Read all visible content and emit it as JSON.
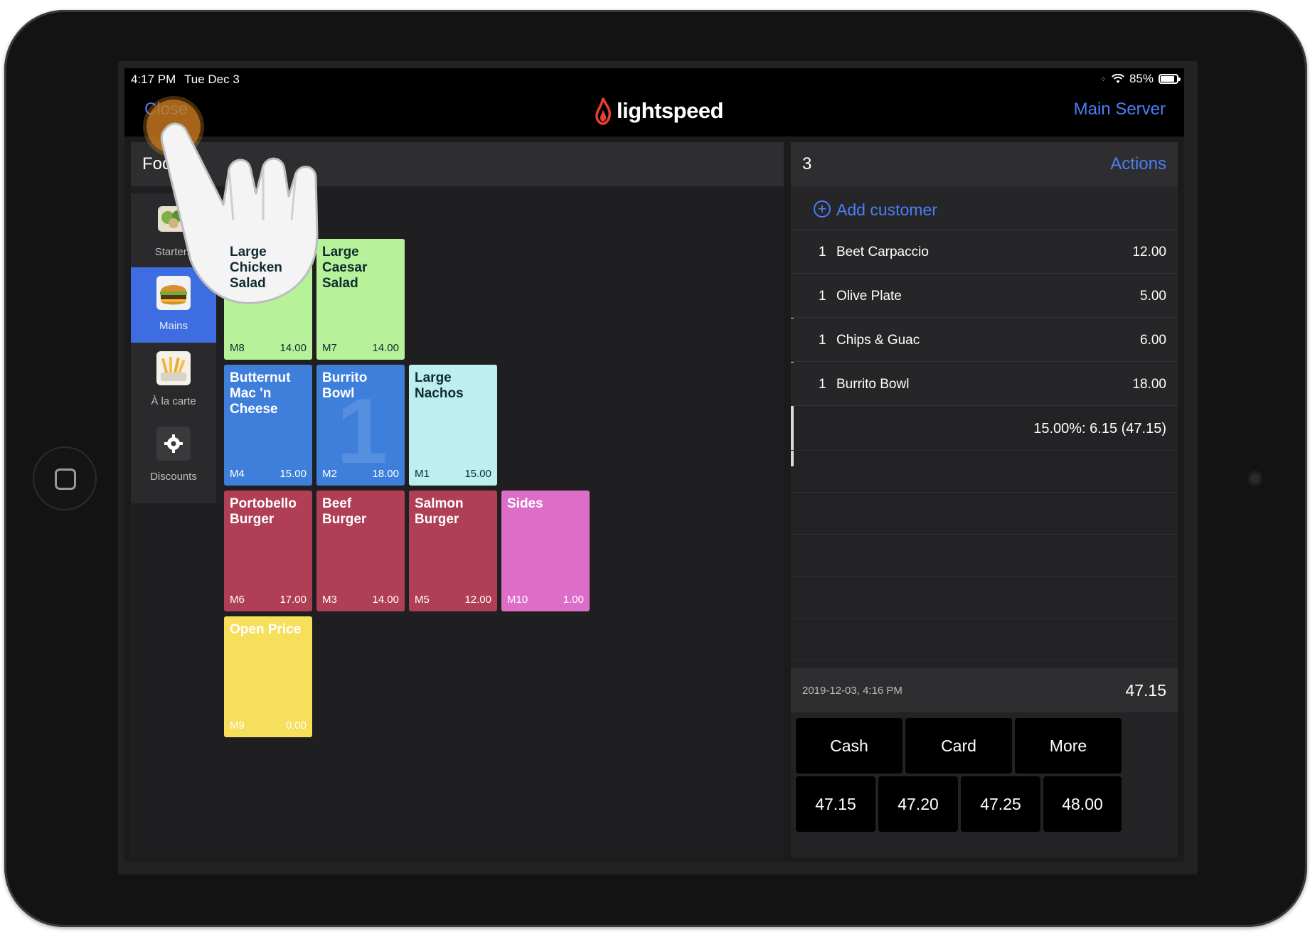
{
  "status_bar": {
    "time": "4:17 PM",
    "date": "Tue Dec 3",
    "battery": "85%",
    "battery_level": 0.85
  },
  "nav": {
    "close": "Close",
    "logo": "lightspeed",
    "server": "Main Server"
  },
  "category": {
    "label": "Food"
  },
  "sidebar": [
    {
      "label": "Starters",
      "icon": "salad-icon",
      "active": false
    },
    {
      "label": "Mains",
      "icon": "burger-icon",
      "active": true
    },
    {
      "label": "À la carte",
      "icon": "fries-icon",
      "active": false
    },
    {
      "label": "Discounts",
      "icon": "discount-gear-icon",
      "active": false
    }
  ],
  "tiles": [
    {
      "name": "Large Chicken Salad",
      "code": "M8",
      "price": "14.00",
      "color": "#b7f29a"
    },
    {
      "name": "Large Caesar Salad",
      "code": "M7",
      "price": "14.00",
      "color": "#b7f29a"
    },
    {
      "name": "Butternut Mac 'n Cheese",
      "code": "M4",
      "price": "15.00",
      "color": "#3f7fdc"
    },
    {
      "name": "Burrito Bowl",
      "code": "M2",
      "price": "18.00",
      "color": "#3f7fdc",
      "badge": "1"
    },
    {
      "name": "Large Nachos",
      "code": "M1",
      "price": "15.00",
      "color": "#bdeef0"
    },
    {
      "name": "Portobello Burger",
      "code": "M6",
      "price": "17.00",
      "color": "#b03f55"
    },
    {
      "name": "Beef Burger",
      "code": "M3",
      "price": "14.00",
      "color": "#b03f55"
    },
    {
      "name": "Salmon Burger",
      "code": "M5",
      "price": "12.00",
      "color": "#b03f55"
    },
    {
      "name": "Sides",
      "code": "M10",
      "price": "1.00",
      "color": "#dd6ec8"
    },
    {
      "name": "Open Price",
      "code": "M9",
      "price": "0.00",
      "color": "#f6df5a"
    }
  ],
  "order": {
    "number": "3",
    "actions": "Actions",
    "add_customer": "Add customer",
    "items": [
      {
        "qty": "1",
        "name": "Beet Carpaccio",
        "price": "12.00"
      },
      {
        "qty": "1",
        "name": "Olive Plate",
        "price": "5.00"
      },
      {
        "qty": "1",
        "name": "Chips & Guac",
        "price": "6.00"
      },
      {
        "qty": "1",
        "name": "Burrito Bowl",
        "price": "18.00"
      }
    ],
    "tax": "15.00%: 6.15 (47.15)",
    "timestamp": "2019-12-03, 4:16 PM",
    "total": "47.15"
  },
  "payment": {
    "methods": [
      "Cash",
      "Card",
      "More"
    ],
    "quick_amounts": [
      "47.15",
      "47.20",
      "47.25",
      "48.00"
    ]
  },
  "colors": {
    "accent": "#4a7ef6",
    "active_category": "#3d6de0",
    "tap_indicator": "#c97a20"
  }
}
